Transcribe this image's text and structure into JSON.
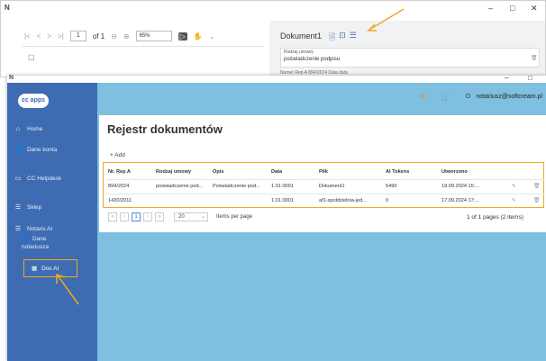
{
  "back_window": {
    "logo": "N",
    "controls": [
      "–",
      "□",
      "✕"
    ],
    "pdf_toolbar": {
      "page": "1",
      "of": "of 1",
      "zoom": "65%"
    },
    "doc_title": "Dokument1",
    "field_label": "Rodzaj umowy",
    "field_value": "poświadczenie podpisu",
    "row2_labels": "Numer Rep A   894/2024      Data   data"
  },
  "front_window": {
    "logo": "N",
    "controls": [
      "–",
      "□"
    ],
    "app_logo": "cc apps",
    "sidebar": {
      "home": "Home",
      "dane_konta": "Dane konta",
      "helpdesk": "CC Helpdesk",
      "sklep": "Sklep",
      "notaris_ai": "Notaris AI",
      "dane_notariusza_1": "Dane",
      "dane_notariusza_2": "notariusza",
      "doc_ai": "Doc AI"
    },
    "topbar": {
      "user": "notariusz@softcream.pl"
    },
    "page_title": "Rejestr dokumentów",
    "add_label": "+ Add",
    "table": {
      "headers": [
        "Nr. Rep A",
        "Rodzaj umowy",
        "Opis",
        "Data",
        "Plik",
        "AI Tokens",
        "Utworzono"
      ],
      "rows": [
        [
          "894/2024",
          "poświadczenie pod...",
          "Poświadczenie pod...",
          "1.01.0001",
          "Dokument1",
          "5490",
          "19.09.2024 15:..."
        ],
        [
          "1430/2011",
          "",
          "",
          "1.01.0001",
          "af1-spoldzielnia-jed...",
          "0",
          "17.09.2024 17:..."
        ]
      ]
    },
    "pager": {
      "current_page": "1",
      "page_size": "20",
      "items_per_page": "Items per page",
      "info": "1 of 1 pages (2 items)"
    }
  },
  "colors": {
    "sidebar": "#3d6cb2",
    "topbar": "#7fbfe0",
    "highlight": "#f5a623"
  }
}
